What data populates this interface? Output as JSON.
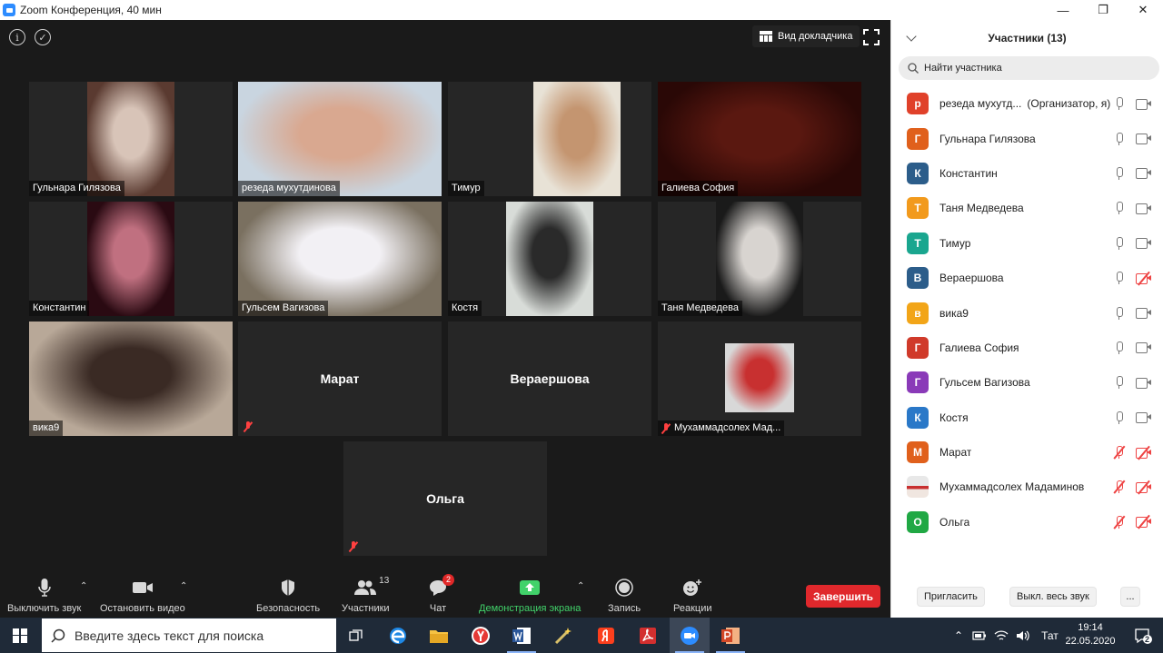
{
  "window": {
    "title": "Zoom Конференция, 40 мин",
    "controls": [
      "—",
      "❐",
      "✕"
    ]
  },
  "meeting": {
    "speaker_view_label": "Вид докладчика",
    "tiles": [
      {
        "name": "Гульнара Гилязова",
        "video": true,
        "colors": [
          "#5a3a30",
          "#d8c4b8"
        ]
      },
      {
        "name": "резеда мухутдинова",
        "video": true,
        "active": true,
        "colors": [
          "#c9d5e0",
          "#d9a890"
        ]
      },
      {
        "name": "Тимур",
        "video": true,
        "colors": [
          "#e8e2d6",
          "#c49570"
        ]
      },
      {
        "name": "Галиева София",
        "video": true,
        "colors": [
          "#2a0806",
          "#5a1810"
        ]
      },
      {
        "name": "Константин",
        "video": true,
        "colors": [
          "#2a0a12",
          "#c07080"
        ]
      },
      {
        "name": "Гульсем Вагизова",
        "video": true,
        "colors": [
          "#7a7060",
          "#f2f0f4"
        ]
      },
      {
        "name": "Костя",
        "video": true,
        "colors": [
          "#d8dcd8",
          "#2a2a2a"
        ]
      },
      {
        "name": "Таня Медведева",
        "video": true,
        "colors": [
          "#1a1a1a",
          "#d8d4d0"
        ]
      },
      {
        "name": "вика9",
        "video": true,
        "colors": [
          "#b8a898",
          "#3a2a24"
        ]
      },
      {
        "name": "Марат",
        "video": false,
        "muted": true
      },
      {
        "name": "Вераершова",
        "video": false,
        "muted": false
      },
      {
        "name": "Мухаммадсолех Мад...",
        "video": true,
        "muted": true,
        "colors": [
          "#d8d8d8",
          "#c83030"
        ]
      },
      {
        "name": "Ольга",
        "video": false,
        "muted": true
      }
    ]
  },
  "toolbar": {
    "mute": "Выключить звук",
    "video": "Остановить видео",
    "security": "Безопасность",
    "participants": "Участники",
    "participants_count": "13",
    "chat": "Чат",
    "chat_badge": "2",
    "share": "Демонстрация экрана",
    "record": "Запись",
    "reactions": "Реакции",
    "end": "Завершить"
  },
  "panel": {
    "title": "Участники (13)",
    "search_placeholder": "Найти участника",
    "participants": [
      {
        "initial": "р",
        "name": "резеда мухутд...",
        "role": "(Организатор, я)",
        "color": "#e0412a",
        "mic_off": false,
        "cam_off": false
      },
      {
        "initial": "Г",
        "name": "Гульнара Гилязова",
        "color": "#e0601c",
        "mic_off": false,
        "cam_off": false
      },
      {
        "initial": "К",
        "name": "Константин",
        "color": "#2c5d8a",
        "mic_off": false,
        "cam_off": false
      },
      {
        "initial": "Т",
        "name": "Таня Медведева",
        "color": "#f29a1c",
        "mic_off": false,
        "cam_off": false
      },
      {
        "initial": "Т",
        "name": "Тимур",
        "color": "#1aa68f",
        "mic_off": false,
        "cam_off": false
      },
      {
        "initial": "В",
        "name": "Вераершова",
        "color": "#2c5d8a",
        "mic_off": false,
        "cam_off": true
      },
      {
        "initial": "в",
        "name": "вика9",
        "color": "#f2a518",
        "mic_off": false,
        "cam_off": false
      },
      {
        "initial": "Г",
        "name": "Галиева София",
        "color": "#d03a2a",
        "mic_off": false,
        "cam_off": false
      },
      {
        "initial": "Г",
        "name": "Гульсем Вагизова",
        "color": "#8a3ab8",
        "mic_off": false,
        "cam_off": false
      },
      {
        "initial": "К",
        "name": "Костя",
        "color": "#2a78c8",
        "mic_off": false,
        "cam_off": false
      },
      {
        "initial": "М",
        "name": "Марат",
        "color": "#e0601c",
        "mic_off": true,
        "cam_off": true
      },
      {
        "initial": "",
        "name": "Мухаммадсолех Мадаминов",
        "color": "#c8c0b8",
        "picture": true,
        "mic_off": true,
        "cam_off": true
      },
      {
        "initial": "О",
        "name": "Ольга",
        "color": "#20a844",
        "mic_off": true,
        "cam_off": true
      }
    ],
    "invite": "Пригласить",
    "mute_all": "Выкл. весь звук",
    "more": "..."
  },
  "taskbar": {
    "search_placeholder": "Введите здесь текст для поиска",
    "language": "Тат",
    "time": "19:14",
    "date": "22.05.2020",
    "notifications": "2"
  }
}
